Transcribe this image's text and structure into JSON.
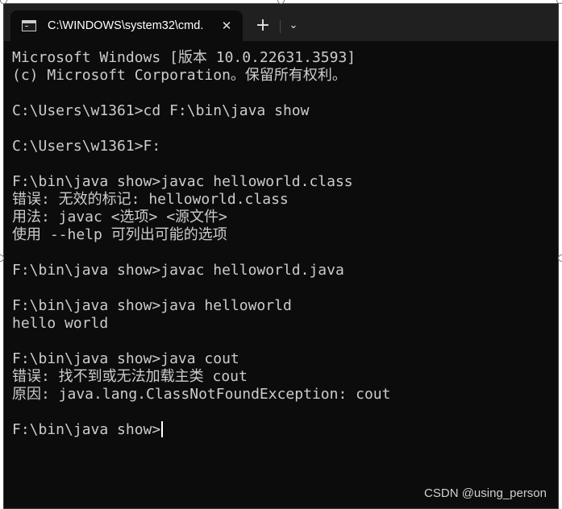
{
  "window": {
    "tab_title": "C:\\WINDOWS\\system32\\cmd.",
    "close_glyph": "✕",
    "new_tab_glyph": "+",
    "dropdown_glyph": "⌄",
    "icon": "terminal-icon"
  },
  "console": {
    "lines": [
      "Microsoft Windows [版本 10.0.22631.3593]",
      "(c) Microsoft Corporation。保留所有权利。",
      "",
      "C:\\Users\\w1361>cd F:\\bin\\java show",
      "",
      "C:\\Users\\w1361>F:",
      "",
      "F:\\bin\\java show>javac helloworld.class",
      "错误: 无效的标记: helloworld.class",
      "用法: javac <选项> <源文件>",
      "使用 --help 可列出可能的选项",
      "",
      "F:\\bin\\java show>javac helloworld.java",
      "",
      "F:\\bin\\java show>java helloworld",
      "hello world",
      "",
      "F:\\bin\\java show>java cout",
      "错误: 找不到或无法加载主类 cout",
      "原因: java.lang.ClassNotFoundException: cout",
      "",
      "F:\\bin\\java show>"
    ]
  },
  "watermark": "CSDN @using_person",
  "colors": {
    "console_bg": "#0c0c0c",
    "console_text": "#cccccc",
    "titlebar_bg": "#202020"
  }
}
